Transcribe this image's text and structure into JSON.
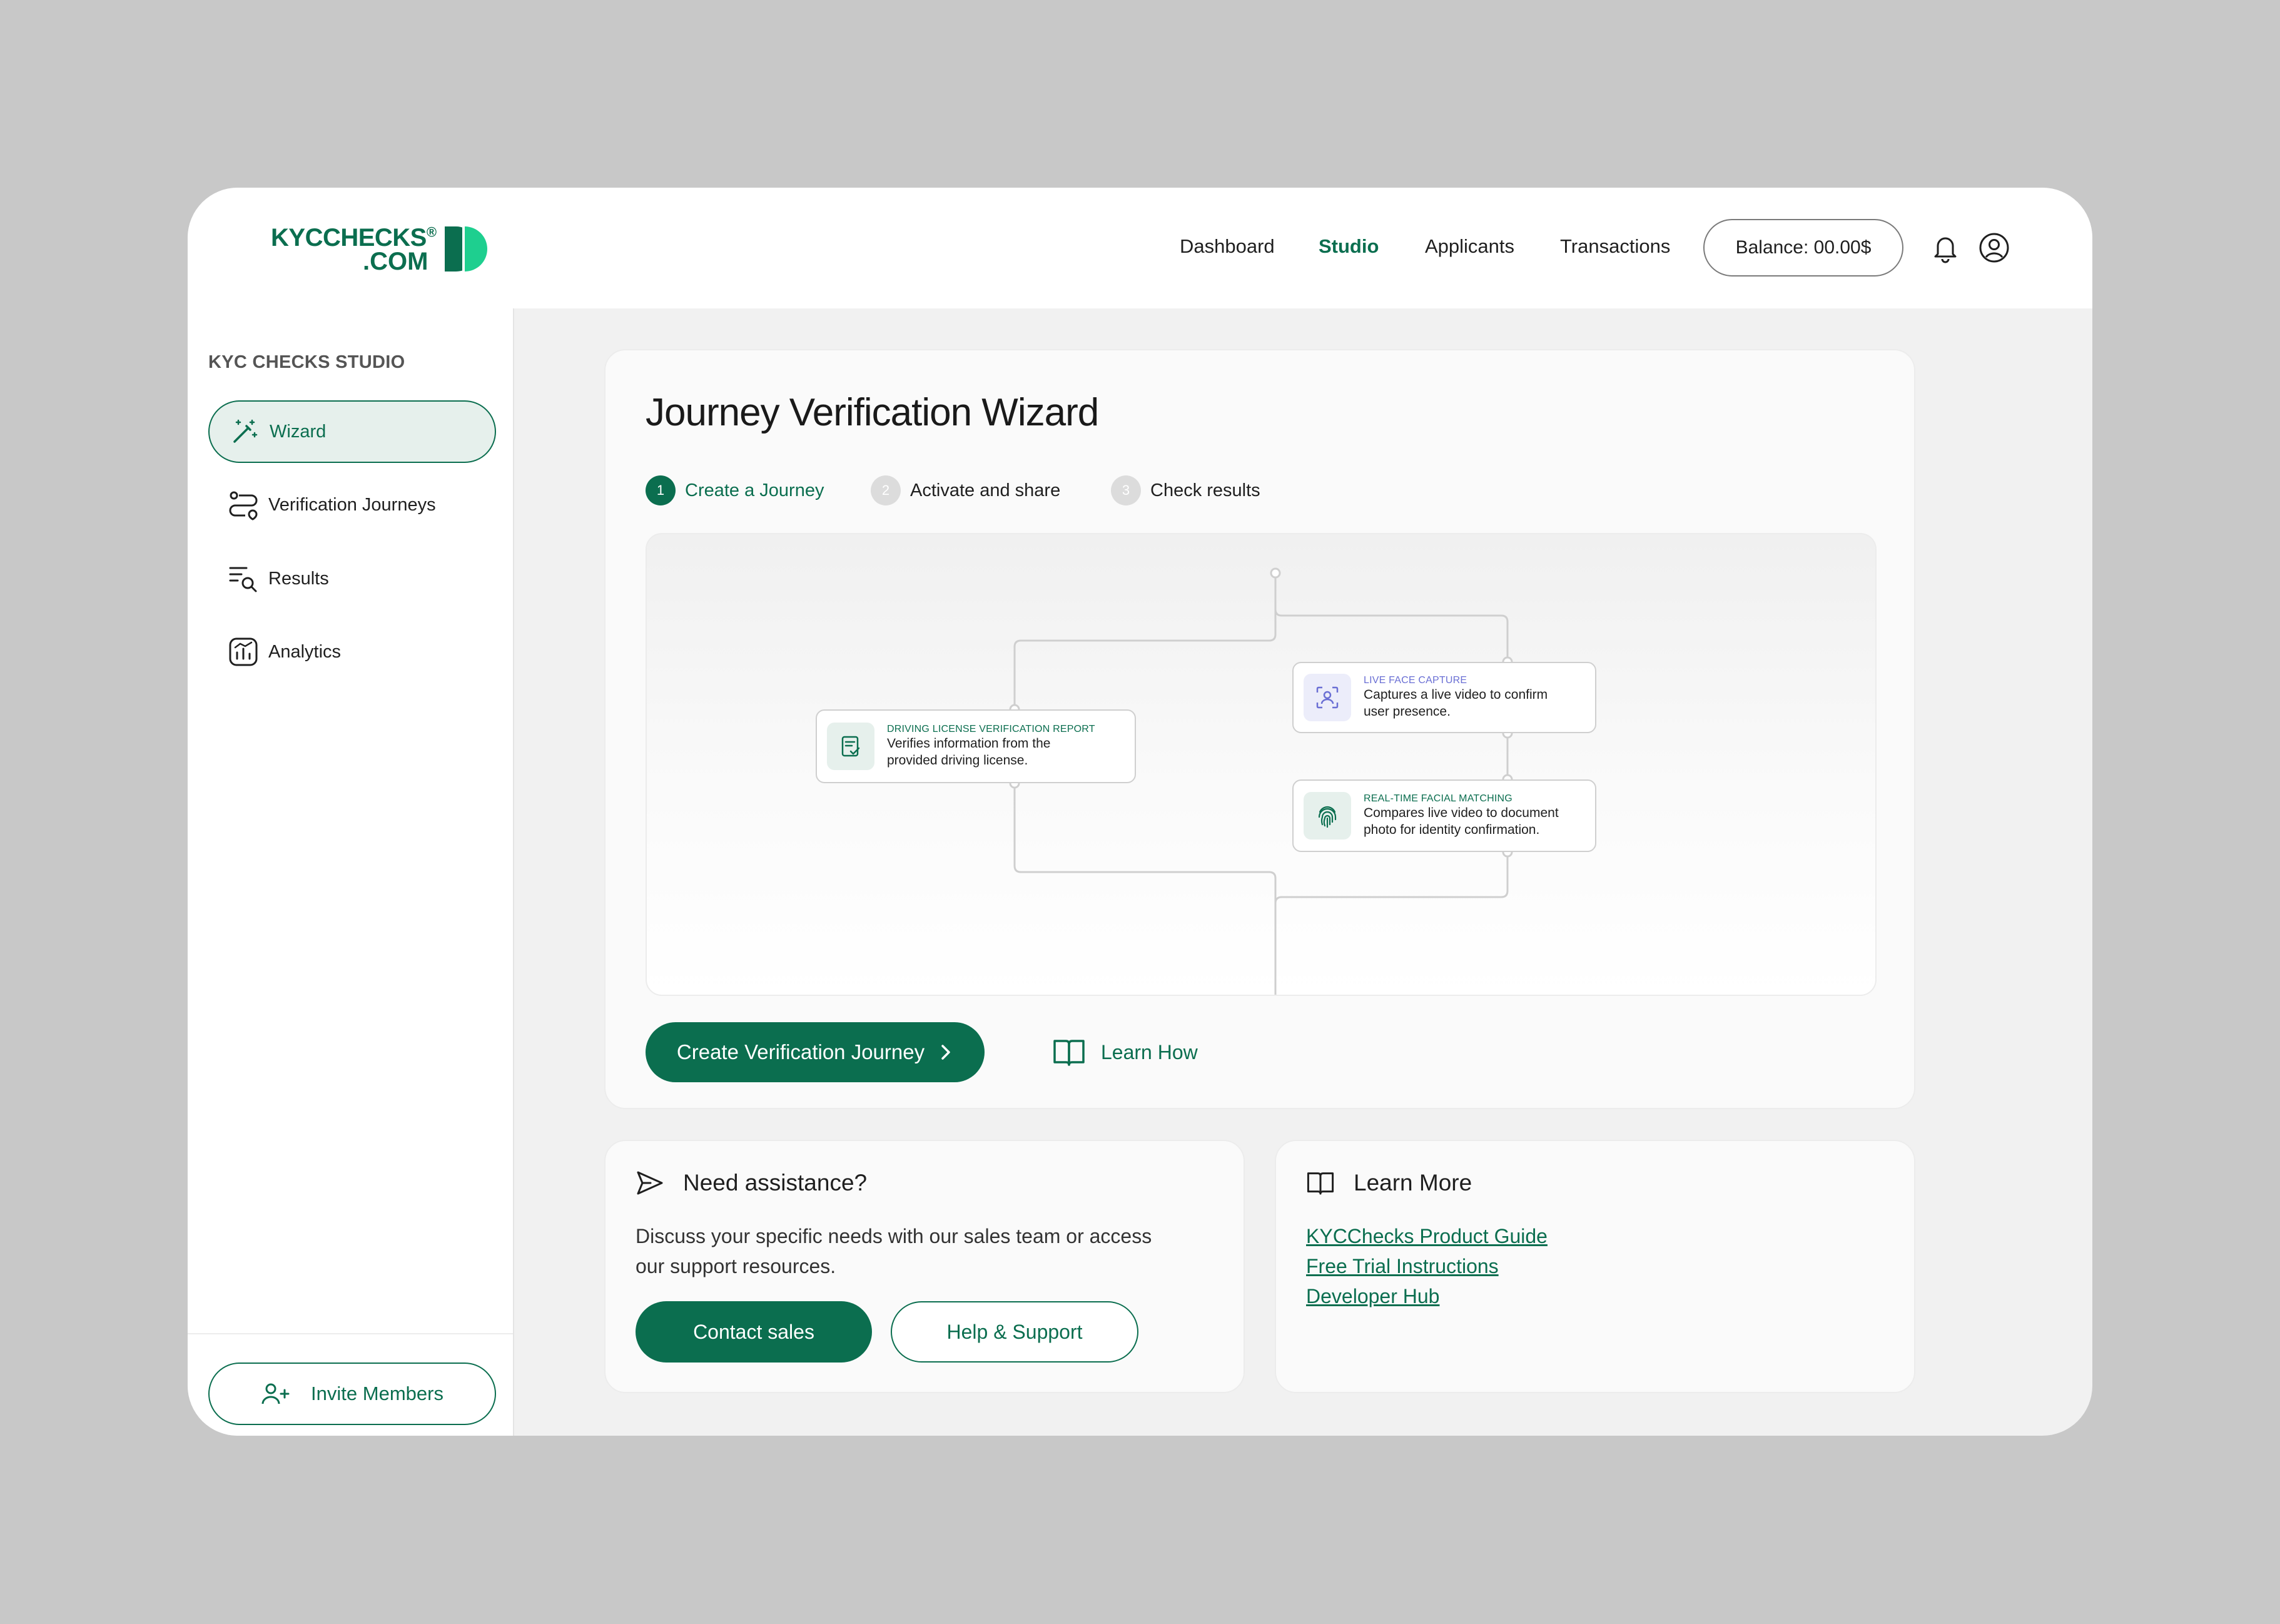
{
  "logo": {
    "line1": "KYCCHECKS",
    "registered": "®",
    "line2": ".COM"
  },
  "nav": {
    "items": [
      {
        "label": "Dashboard",
        "active": false
      },
      {
        "label": "Studio",
        "active": true
      },
      {
        "label": "Applicants",
        "active": false
      },
      {
        "label": "Transactions",
        "active": false
      }
    ],
    "balance": "Balance: 00.00$"
  },
  "sidebar": {
    "title": "KYC CHECKS STUDIO",
    "items": [
      {
        "label": "Wizard",
        "icon": "magic-wand-icon",
        "active": true
      },
      {
        "label": "Verification Journeys",
        "icon": "route-icon",
        "active": false
      },
      {
        "label": "Results",
        "icon": "list-search-icon",
        "active": false
      },
      {
        "label": "Analytics",
        "icon": "chart-icon",
        "active": false
      }
    ],
    "invite_label": "Invite Members"
  },
  "wizard": {
    "title": "Journey Verification Wizard",
    "steps": [
      {
        "num": "1",
        "label": "Create a Journey",
        "active": true
      },
      {
        "num": "2",
        "label": "Activate and share",
        "active": false
      },
      {
        "num": "3",
        "label": "Check results",
        "active": false
      }
    ],
    "nodes": [
      {
        "tag": "DRIVING LICENSE VERIFICATION REPORT",
        "desc": "Verifies information from the provided driving license.",
        "icon": "document-check-icon",
        "tag_color": "#0b6e4f"
      },
      {
        "tag": "LIVE FACE CAPTURE",
        "desc": "Captures a live video to confirm user presence.",
        "icon": "face-scan-icon",
        "tag_color": "#6a6fd4"
      },
      {
        "tag": "REAL-TIME FACIAL MATCHING",
        "desc": "Compares live video to document photo for identity confirmation.",
        "icon": "fingerprint-icon",
        "tag_color": "#0b6e4f"
      }
    ],
    "create_button": "Create Verification Journey",
    "learn_how": "Learn How"
  },
  "assist": {
    "title": "Need assistance?",
    "text": "Discuss your specific needs with our sales team or access our support resources.",
    "contact_label": "Contact sales",
    "support_label": "Help & Support"
  },
  "learn_more": {
    "title": "Learn More",
    "links": [
      "KYCChecks Product Guide",
      "Free Trial Instructions",
      "Developer Hub"
    ]
  },
  "colors": {
    "brand": "#0b6e4f",
    "accent": "#1ecf8f",
    "purple": "#6a6fd4"
  }
}
